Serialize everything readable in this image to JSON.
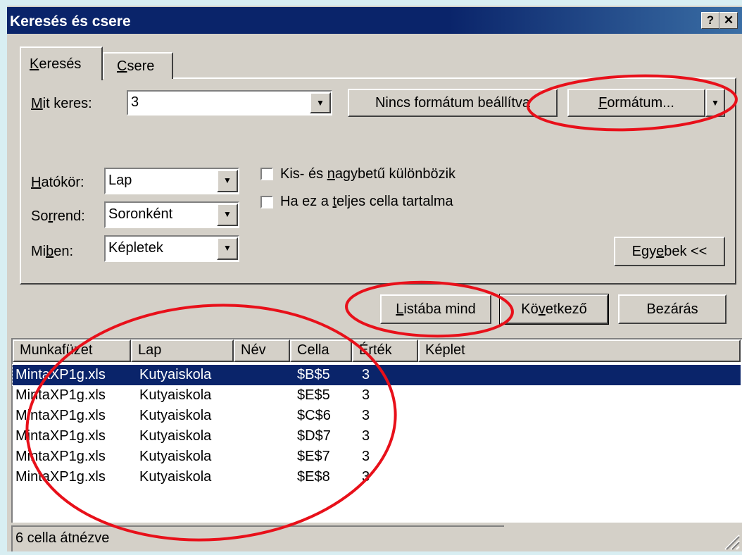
{
  "window": {
    "title": "Keresés és csere",
    "help_icon": "?",
    "close_icon": "✕"
  },
  "tabs": [
    {
      "pre": "",
      "hot": "K",
      "post": "eresés",
      "active": true
    },
    {
      "pre": "",
      "hot": "C",
      "post": "sere",
      "active": false
    }
  ],
  "find": {
    "label_pre": "",
    "label_hot": "M",
    "label_post": "it keres:",
    "value": "3",
    "no_format_label": "Nincs formátum beállítva",
    "format_pre": "",
    "format_hot": "F",
    "format_post": "ormátum..."
  },
  "options": {
    "scope": {
      "label_pre": "",
      "label_hot": "H",
      "label_post": "atókör:",
      "value": "Lap"
    },
    "order": {
      "label_pre": "So",
      "label_hot": "r",
      "label_post": "rend:",
      "value": "Soronként"
    },
    "look_in": {
      "label_pre": "Mi",
      "label_hot": "b",
      "label_post": "en:",
      "value": "Képletek"
    },
    "match_case": {
      "pre": "Kis- és ",
      "hot": "n",
      "post": "agybetű különbözik",
      "checked": false
    },
    "whole_cell": {
      "pre": "Ha ez a ",
      "hot": "t",
      "post": "eljes cella tartalma",
      "checked": false
    },
    "more_pre": "Egy",
    "more_hot": "e",
    "more_post": "bek <<"
  },
  "actions": {
    "find_all_pre": "",
    "find_all_hot": "L",
    "find_all_post": "istába mind",
    "find_next_pre": "Kö",
    "find_next_hot": "v",
    "find_next_post": "etkező",
    "close": "Bezárás"
  },
  "results": {
    "columns": [
      "Munkafüzet",
      "Lap",
      "Név",
      "Cella",
      "Érték",
      "Képlet"
    ],
    "rows": [
      [
        "MintaXP1g.xls",
        "Kutyaiskola",
        "",
        "$B$5",
        "3",
        ""
      ],
      [
        "MintaXP1g.xls",
        "Kutyaiskola",
        "",
        "$E$5",
        "3",
        ""
      ],
      [
        "MintaXP1g.xls",
        "Kutyaiskola",
        "",
        "$C$6",
        "3",
        ""
      ],
      [
        "MintaXP1g.xls",
        "Kutyaiskola",
        "",
        "$D$7",
        "3",
        ""
      ],
      [
        "MintaXP1g.xls",
        "Kutyaiskola",
        "",
        "$E$7",
        "3",
        ""
      ],
      [
        "MintaXP1g.xls",
        "Kutyaiskola",
        "",
        "$E$8",
        "3",
        ""
      ]
    ],
    "selected_row": 0
  },
  "status": "6 cella átnézve",
  "annotation_color": "#e8101a"
}
